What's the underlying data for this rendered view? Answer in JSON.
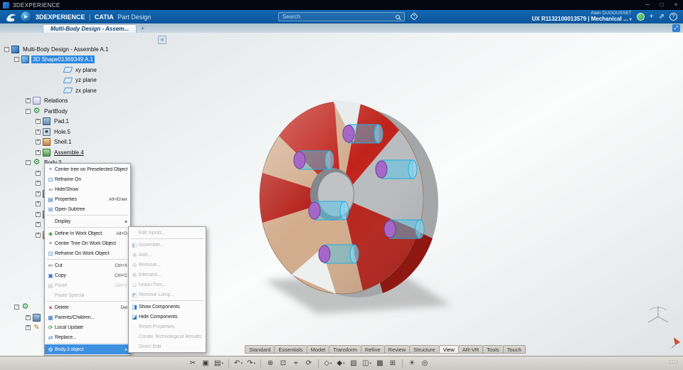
{
  "titlebar": {
    "app_name": "3DEXPERIENCE",
    "minimize": "─",
    "maximize": "□",
    "close": "×"
  },
  "appbar": {
    "brand": "3DEXPERIENCE",
    "divider": "|",
    "app_name": "CATIA",
    "module_name": "Part Design",
    "compass_play": "▶",
    "search_placeholder": "Search",
    "user_name": "Alain DUGOUSSET",
    "workspace_label": "UX R1132100013579 | Mechanical ...",
    "workspace_caret": "▾",
    "add_label": "+",
    "share_glyph": "⇗",
    "help_label": "?"
  },
  "tabbar": {
    "tabs": [
      {
        "label": "Multi-Body Design - Assem...",
        "active": true
      }
    ],
    "new_tab_label": "+",
    "expand_glyph": "⤢"
  },
  "tree": {
    "collapse_glyph": "«",
    "items": [
      {
        "label": "Multi-Body Design - Assemble A.1",
        "indent": 0,
        "icon": "assembly",
        "expander": "minus"
      },
      {
        "label": "3D Shape01369349 A.1",
        "indent": 1,
        "icon": "shape",
        "expander": "minus",
        "selected": true
      },
      {
        "label": "xy plane",
        "indent": 4,
        "icon": "plane",
        "expander": "none"
      },
      {
        "label": "yz plane",
        "indent": 4,
        "icon": "plane",
        "expander": "none"
      },
      {
        "label": "zx plane",
        "indent": 4,
        "icon": "plane",
        "expander": "none"
      },
      {
        "label": "Relations",
        "indent": 2,
        "icon": "relations",
        "expander": "plus"
      },
      {
        "label": "PartBody",
        "indent": 2,
        "icon": "partbody",
        "glyph": "⚙",
        "expander": "minus"
      },
      {
        "label": "Pad.1",
        "indent": 3,
        "icon": "pad",
        "expander": "plus"
      },
      {
        "label": "Hole.5",
        "indent": 3,
        "icon": "hole",
        "expander": "plus"
      },
      {
        "label": "Shell.1",
        "indent": 3,
        "icon": "shell",
        "expander": "plus"
      },
      {
        "label": "Assemble.4",
        "indent": 3,
        "icon": "assemble",
        "expander": "plus",
        "underline": true
      },
      {
        "label": "Body.3",
        "indent": 2,
        "icon": "body",
        "glyph": "⚙",
        "expander": "minus"
      },
      {
        "label": "",
        "indent": 3,
        "icon": "feature",
        "glyph": "✎",
        "expander": "plus"
      },
      {
        "label": "",
        "indent": 3,
        "icon": "feature",
        "glyph": "✎",
        "expander": "plus"
      },
      {
        "label": "",
        "indent": 3,
        "icon": "pad",
        "expander": "plus"
      },
      {
        "label": "",
        "indent": 3,
        "icon": "feature",
        "glyph": "✎",
        "expander": "plus"
      },
      {
        "label": "",
        "indent": 3,
        "icon": "pad",
        "expander": "plus"
      },
      {
        "label": "",
        "indent": 3,
        "icon": "feature",
        "glyph": "✎",
        "expander": "plus"
      },
      {
        "label": "",
        "indent": 3,
        "icon": "shell",
        "expander": "plus"
      },
      {
        "label": "",
        "indent": 5,
        "icon": "blank",
        "expander": "none"
      },
      {
        "label": "",
        "indent": 5,
        "icon": "blank",
        "expander": "none"
      },
      {
        "label": "",
        "indent": 5,
        "icon": "blank",
        "expander": "none"
      },
      {
        "label": "",
        "indent": 5,
        "icon": "blank",
        "expander": "none"
      },
      {
        "label": "",
        "indent": 5,
        "icon": "blank",
        "expander": "none"
      },
      {
        "label": "",
        "indent": 5,
        "icon": "blank",
        "expander": "none"
      },
      {
        "label": "",
        "indent": 1,
        "icon": "body",
        "glyph": "⚙",
        "expander": "minus"
      },
      {
        "label": "",
        "indent": 2,
        "icon": "pad",
        "expander": "plus"
      },
      {
        "label": "",
        "indent": 2,
        "icon": "feature",
        "glyph": "✎",
        "expander": "plus"
      }
    ]
  },
  "context_menu": {
    "items": [
      {
        "label": "Center tree on Preselected Objects",
        "icon": "center-tree-icon",
        "glyph": "⌖"
      },
      {
        "label": "Reframe On",
        "icon": "reframe-icon",
        "glyph": "⊡"
      },
      {
        "label": "Hide/Show",
        "icon": "hide-show-icon",
        "glyph": "∞"
      },
      {
        "label": "Properties",
        "shortcut": "Alt+Enter",
        "icon": "properties-icon",
        "glyph": "▤"
      },
      {
        "label": "Open Subtree",
        "icon": "open-subtree-icon",
        "glyph": "⊞",
        "separator_after": true
      },
      {
        "label": "Display",
        "submenu": true,
        "separator_after": true
      },
      {
        "label": "Define In Work Object",
        "shortcut": "Alt+D",
        "icon": "define-work-icon",
        "glyph": "◈"
      },
      {
        "label": "Center Tree On Work Object",
        "icon": "center-work-icon",
        "glyph": "⌖"
      },
      {
        "label": "Reframe On Work Object",
        "icon": "reframe-work-icon",
        "glyph": "⊡",
        "separator_after": true
      },
      {
        "label": "Cut",
        "shortcut": "Ctrl+X",
        "icon": "cut-icon",
        "glyph": "✂"
      },
      {
        "label": "Copy",
        "shortcut": "Ctrl+C",
        "icon": "copy-icon",
        "glyph": "▣"
      },
      {
        "label": "Paste",
        "shortcut": "Ctrl+V",
        "icon": "paste-icon",
        "glyph": "▤",
        "disabled": true
      },
      {
        "label": "Paste Special",
        "disabled": true,
        "separator_after": true
      },
      {
        "label": "Delete",
        "shortcut": "Del",
        "icon": "delete-icon",
        "glyph": "×"
      },
      {
        "label": "Parents/Children...",
        "icon": "parents-children-icon",
        "glyph": "▦"
      },
      {
        "label": "Local Update",
        "icon": "local-update-icon",
        "glyph": "⟳"
      },
      {
        "label": "Replace...",
        "icon": "replace-icon",
        "glyph": "⇄",
        "separator_after": true
      },
      {
        "label": "Body.3 object",
        "icon": "body-object-icon",
        "glyph": "⚙",
        "submenu": true,
        "highlighted": true
      }
    ]
  },
  "context_submenu": {
    "items": [
      {
        "label": "Edit Inputs...",
        "disabled": true,
        "separator_after": true
      },
      {
        "label": "Assemble...",
        "icon": "assemble-op-icon",
        "glyph": "◧",
        "disabled": true
      },
      {
        "label": "Add...",
        "icon": "add-op-icon",
        "glyph": "⊕",
        "disabled": true
      },
      {
        "label": "Remove...",
        "icon": "remove-op-icon",
        "glyph": "⊖",
        "disabled": true
      },
      {
        "label": "Intersect...",
        "icon": "intersect-op-icon",
        "glyph": "⊗",
        "disabled": true
      },
      {
        "label": "Union Trim...",
        "icon": "union-trim-icon",
        "glyph": "⊔",
        "disabled": true
      },
      {
        "label": "Remove Lump...",
        "icon": "remove-lump-icon",
        "glyph": "◩",
        "disabled": true,
        "separator_after": true
      },
      {
        "label": "Show Components",
        "icon": "show-components-icon",
        "glyph": "◨"
      },
      {
        "label": "Hide Components",
        "icon": "hide-components-icon",
        "glyph": "◪"
      },
      {
        "label": "Reset Properties",
        "disabled": true
      },
      {
        "label": "Create Technological Results...",
        "disabled": true
      },
      {
        "label": "Direct Edit",
        "disabled": true
      }
    ]
  },
  "ribbon": {
    "tabs": [
      "Standard",
      "Essentials",
      "Model",
      "Transform",
      "Refine",
      "Review",
      "Structure",
      "View",
      "AR-VR",
      "Tools",
      "Touch"
    ],
    "active": "View"
  },
  "toolbar": {
    "items": [
      {
        "name": "cut-tool",
        "glyph": "✂"
      },
      {
        "name": "copy-tool",
        "glyph": "▣"
      },
      {
        "name": "paste-tool",
        "glyph": "▤",
        "dropdown": true
      },
      {
        "sep": true
      },
      {
        "name": "undo-button",
        "glyph": "↶",
        "dropdown": true
      },
      {
        "name": "redo-button",
        "glyph": "↷",
        "dropdown": true
      },
      {
        "sep": true
      },
      {
        "name": "zoom-in-tool",
        "glyph": "⊕"
      },
      {
        "name": "zoom-fit-tool",
        "glyph": "⊡"
      },
      {
        "name": "pan-tool",
        "glyph": "⌖"
      },
      {
        "name": "rotate-tool",
        "glyph": "⟳"
      },
      {
        "sep": true
      },
      {
        "name": "view-orientation-tool",
        "glyph": "◇",
        "dropdown": true
      },
      {
        "name": "render-style-tool",
        "glyph": "◆",
        "dropdown": true
      },
      {
        "name": "wireframe-tool",
        "glyph": "▧"
      },
      {
        "name": "section-tool",
        "glyph": "◫",
        "dropdown": true
      },
      {
        "name": "hide-show-space-tool",
        "glyph": "▩"
      },
      {
        "name": "screen-capture-tool",
        "glyph": "⊞"
      },
      {
        "sep": true
      },
      {
        "name": "ambience-tool",
        "glyph": "☀"
      },
      {
        "name": "magnifier-tool",
        "glyph": "◎"
      }
    ],
    "grip": "∷∷"
  },
  "viewport": {
    "colors": {
      "red": "#b51f18",
      "tan": "#d2ac8c",
      "steel": "#b9bcbf",
      "highlight_cyan": "#35c3f2",
      "magenta": "#a667c9",
      "shadow": "#9f9f9f"
    }
  }
}
